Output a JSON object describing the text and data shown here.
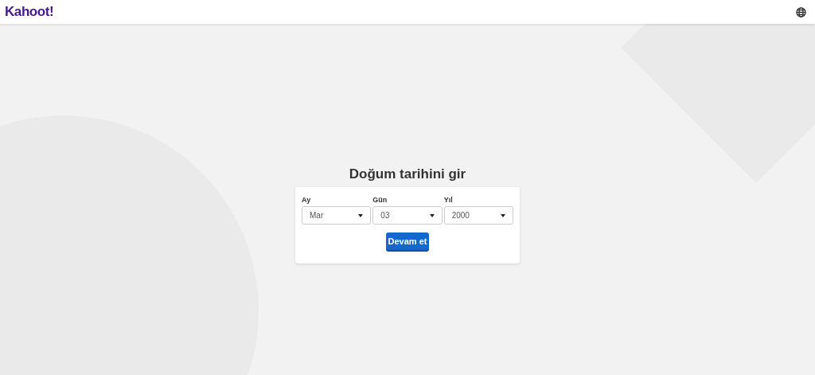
{
  "header": {
    "logo": "Kahoot!"
  },
  "title": "Doğum tarihini gir",
  "fields": [
    {
      "label": "Ay",
      "value": "Mar"
    },
    {
      "label": "Gün",
      "value": "03"
    },
    {
      "label": "Yıl",
      "value": "2000"
    }
  ],
  "button": "Devam et"
}
